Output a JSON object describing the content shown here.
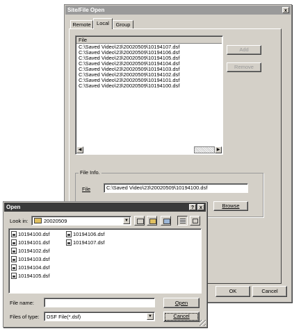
{
  "site_dialog": {
    "title": "Site/File Open",
    "close_glyph": "x",
    "tabs": [
      "Remote",
      "Local",
      "Group"
    ],
    "list_header": "File",
    "files": [
      "C:\\Saved Video\\23\\20020509\\10194107.dsf",
      "C:\\Saved Video\\23\\20020509\\10194106.dsf",
      "C:\\Saved Video\\23\\20020509\\10194105.dsf",
      "C:\\Saved Video\\23\\20020509\\10194104.dsf",
      "C:\\Saved Video\\23\\20020509\\10194103.dsf",
      "C:\\Saved Video\\23\\20020509\\10194102.dsf",
      "C:\\Saved Video\\23\\20020509\\10194101.dsf",
      "C:\\Saved Video\\23\\20020509\\10194100.dsf"
    ],
    "add_label": "Add",
    "remove_label": "Remove",
    "file_info_label": "File Info.",
    "file_label": "File",
    "file_value": "C:\\Saved Video\\23\\20020509\\10194100.dsf",
    "browse_label": "Browse",
    "ok_label": "OK",
    "cancel_label": "Cancel"
  },
  "open_dialog": {
    "title": "Open",
    "help_glyph": "?",
    "close_glyph": "x",
    "look_in_label": "Look in:",
    "look_in_value": "20020509",
    "files_col1": [
      "10194100.dsf",
      "10194101.dsf",
      "10194102.dsf",
      "10194103.dsf",
      "10194104.dsf",
      "10194105.dsf"
    ],
    "files_col2": [
      "10194106.dsf",
      "10194107.dsf"
    ],
    "file_name_label": "File name:",
    "file_name_value": "",
    "file_type_label": "Files of type:",
    "file_type_value": "DSF File(*.dsf)",
    "open_label": "Open",
    "cancel_label": "Cancel"
  }
}
